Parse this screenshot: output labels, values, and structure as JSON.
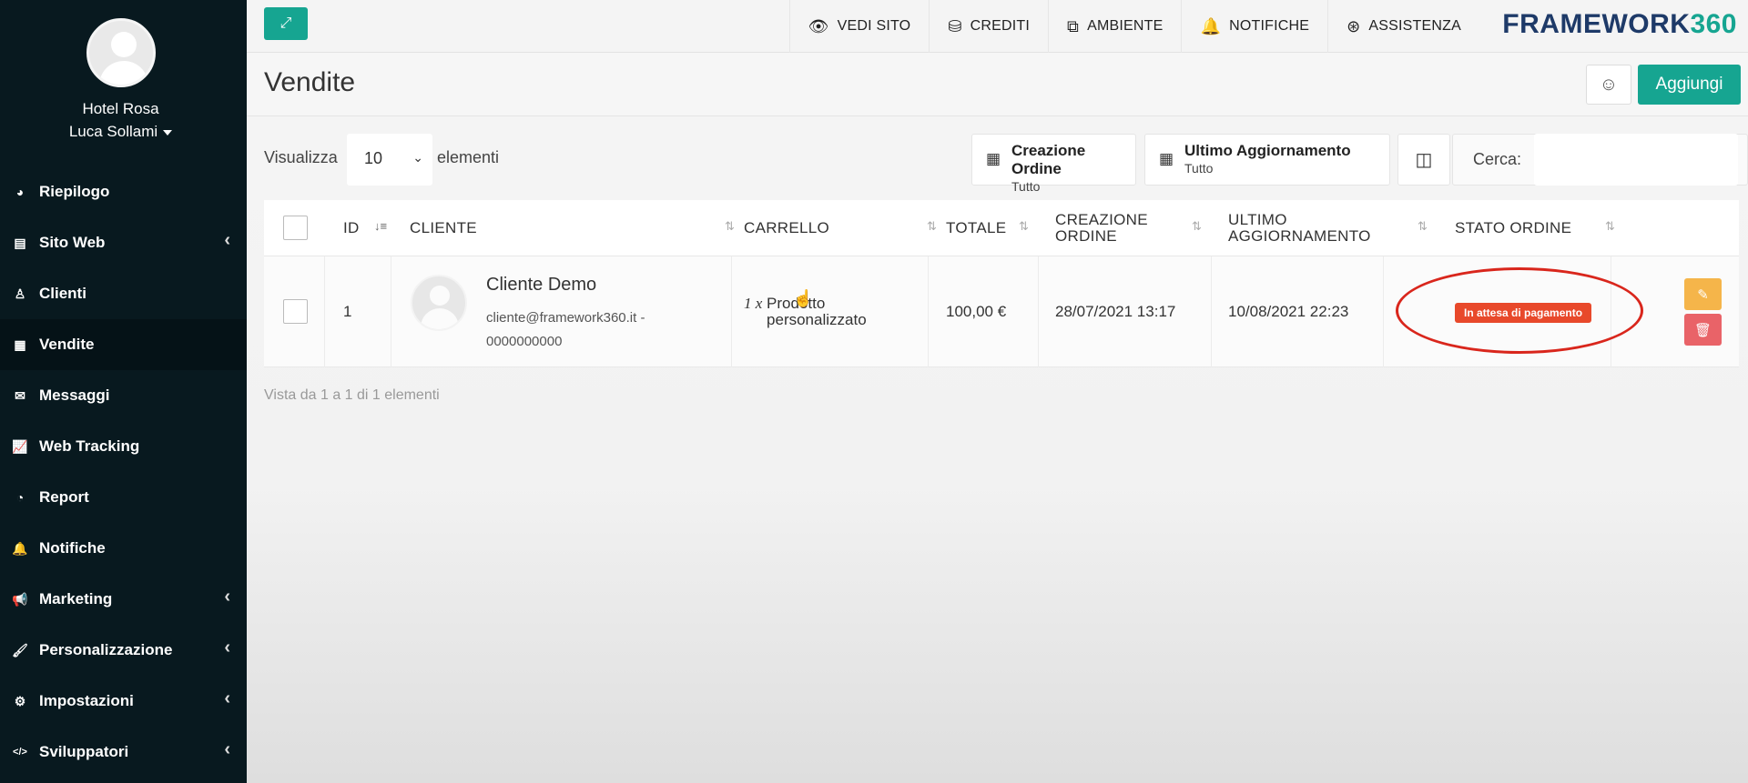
{
  "sidebar": {
    "hotel": "Hotel Rosa",
    "user": "Luca Sollami",
    "items": [
      {
        "label": "Riepilogo",
        "icon": "dashboard-icon",
        "glyph": "◕",
        "chevron": false
      },
      {
        "label": "Sito Web",
        "icon": "file-icon",
        "glyph": "▤",
        "chevron": true
      },
      {
        "label": "Clienti",
        "icon": "person-icon",
        "glyph": "♙",
        "chevron": false
      },
      {
        "label": "Vendite",
        "icon": "calculator-icon",
        "glyph": "▦",
        "chevron": false,
        "active": true
      },
      {
        "label": "Messaggi",
        "icon": "envelope-icon",
        "glyph": "✉",
        "chevron": false
      },
      {
        "label": "Web Tracking",
        "icon": "line-chart-icon",
        "glyph": "📈",
        "chevron": false
      },
      {
        "label": "Report",
        "icon": "pie-chart-icon",
        "glyph": "◔",
        "chevron": false
      },
      {
        "label": "Notifiche",
        "icon": "bell-icon",
        "glyph": "🔔",
        "chevron": false
      },
      {
        "label": "Marketing",
        "icon": "megaphone-icon",
        "glyph": "📢",
        "chevron": true
      },
      {
        "label": "Personalizzazione",
        "icon": "brush-icon",
        "glyph": "🖌",
        "chevron": true
      },
      {
        "label": "Impostazioni",
        "icon": "gear-icon",
        "glyph": "⚙",
        "chevron": true
      },
      {
        "label": "Sviluppatori",
        "icon": "code-icon",
        "glyph": "</>",
        "chevron": true
      }
    ]
  },
  "topbar": {
    "links": [
      {
        "label": "VEDI SITO",
        "icon": "eye-icon",
        "glyph": "👁"
      },
      {
        "label": "CREDITI",
        "icon": "coins-icon",
        "glyph": "⛁"
      },
      {
        "label": "AMBIENTE",
        "icon": "cubes-icon",
        "glyph": "⧉"
      },
      {
        "label": "NOTIFICHE",
        "icon": "bell-icon",
        "glyph": "🔔"
      },
      {
        "label": "ASSISTENZA",
        "icon": "lifebuoy-icon",
        "glyph": "⊛"
      }
    ],
    "brand_main": "FRAMEWORK",
    "brand_accent": "360"
  },
  "page": {
    "title": "Vendite",
    "add_label": "Aggiungi"
  },
  "toolbar": {
    "show_label": "Visualizza",
    "show_value": "10",
    "show_suffix": "elementi",
    "filter_creation_title": "Creazione Ordine",
    "filter_creation_value": "Tutto",
    "filter_update_title": "Ultimo Aggiornamento",
    "filter_update_value": "Tutto",
    "search_label": "Cerca:",
    "search_value": ""
  },
  "table": {
    "headers": {
      "id": "ID",
      "client": "CLIENTE",
      "cart": "CARRELLO",
      "total": "TOTALE",
      "created_1": "CREAZIONE",
      "created_2": "ORDINE",
      "updated_1": "ULTIMO",
      "updated_2": "AGGIORNAMENTO",
      "status": "STATO ORDINE"
    },
    "rows": [
      {
        "id": "1",
        "client_name": "Cliente Demo",
        "client_email": "cliente@framework360.it - 0000000000",
        "cart_qty": "1 x",
        "cart_item": "Prodotto personalizzato",
        "total": "100,00 €",
        "created": "28/07/2021 13:17",
        "updated": "10/08/2021 22:23",
        "status": "In attesa di pagamento"
      }
    ],
    "footer": "Vista da 1 a 1 di 1 elementi"
  },
  "colors": {
    "accent": "#16a591",
    "sidebar": "#08191f",
    "status_badge": "#e8492b",
    "highlight_ring": "#d9261c",
    "edit": "#f5b54a",
    "delete": "#e96368"
  }
}
